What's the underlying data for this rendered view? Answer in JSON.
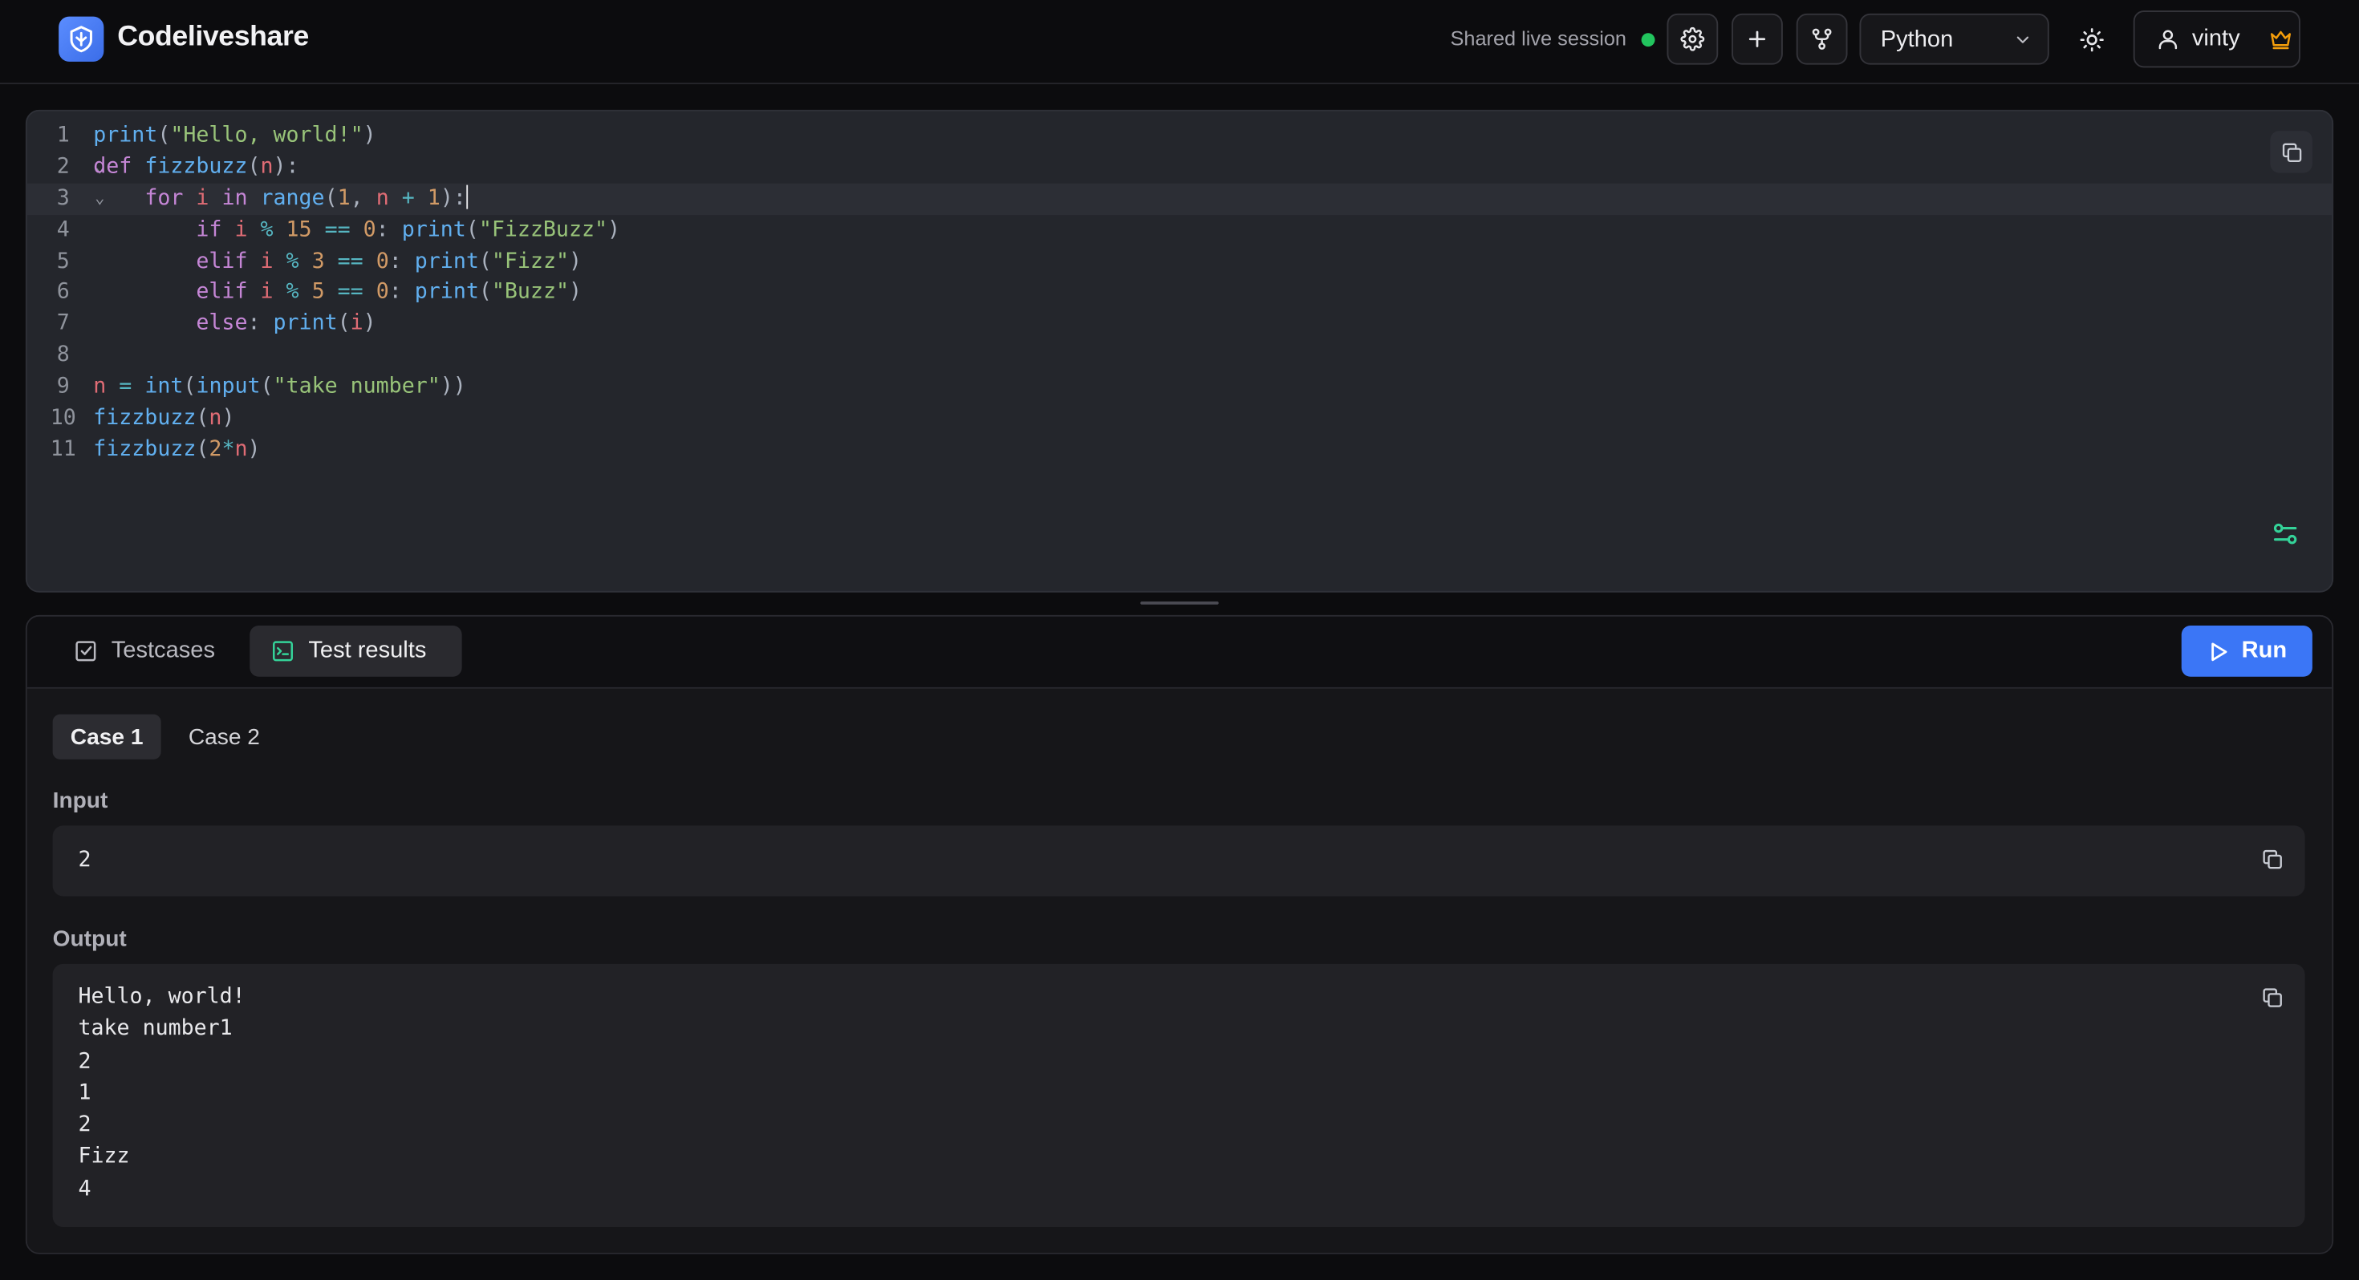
{
  "colors": {
    "accent": "#3b76f6",
    "session_status": "#22c55e",
    "crown": "#f59e0b",
    "settings_accent": "#34d399"
  },
  "header": {
    "brand": "Codeliveshare",
    "session_label": "Shared live session",
    "language": "Python",
    "username": "vinty",
    "icons": [
      "logo-icon",
      "gear-icon",
      "plus-icon",
      "fork-icon",
      "chevron-down-icon",
      "sun-icon",
      "user-icon",
      "crown-icon"
    ]
  },
  "editor": {
    "active_line": 3,
    "lines": [
      {
        "num": "1",
        "fold": false,
        "tokens": [
          {
            "t": "print",
            "c": "f"
          },
          {
            "t": "(",
            "c": "p"
          },
          {
            "t": "\"Hello, world!\"",
            "c": "s"
          },
          {
            "t": ")",
            "c": "p"
          }
        ]
      },
      {
        "num": "2",
        "fold": true,
        "tokens": [
          {
            "t": "def ",
            "c": "k"
          },
          {
            "t": "fizzbuzz",
            "c": "f"
          },
          {
            "t": "(",
            "c": "p"
          },
          {
            "t": "n",
            "c": "v"
          },
          {
            "t": "):",
            "c": "p"
          }
        ]
      },
      {
        "num": "3",
        "fold": true,
        "cursor": true,
        "tokens": [
          {
            "t": "    ",
            "c": "p"
          },
          {
            "t": "for ",
            "c": "k"
          },
          {
            "t": "i ",
            "c": "v"
          },
          {
            "t": "in ",
            "c": "k"
          },
          {
            "t": "range",
            "c": "f"
          },
          {
            "t": "(",
            "c": "p"
          },
          {
            "t": "1",
            "c": "n"
          },
          {
            "t": ", ",
            "c": "p"
          },
          {
            "t": "n ",
            "c": "v"
          },
          {
            "t": "+ ",
            "c": "o"
          },
          {
            "t": "1",
            "c": "n"
          },
          {
            "t": "):",
            "c": "p"
          }
        ]
      },
      {
        "num": "4",
        "fold": false,
        "tokens": [
          {
            "t": "        ",
            "c": "p"
          },
          {
            "t": "if ",
            "c": "k"
          },
          {
            "t": "i ",
            "c": "v"
          },
          {
            "t": "% ",
            "c": "o"
          },
          {
            "t": "15 ",
            "c": "n"
          },
          {
            "t": "== ",
            "c": "o"
          },
          {
            "t": "0",
            "c": "n"
          },
          {
            "t": ": ",
            "c": "p"
          },
          {
            "t": "print",
            "c": "f"
          },
          {
            "t": "(",
            "c": "p"
          },
          {
            "t": "\"FizzBuzz\"",
            "c": "s"
          },
          {
            "t": ")",
            "c": "p"
          }
        ]
      },
      {
        "num": "5",
        "fold": false,
        "tokens": [
          {
            "t": "        ",
            "c": "p"
          },
          {
            "t": "elif ",
            "c": "k"
          },
          {
            "t": "i ",
            "c": "v"
          },
          {
            "t": "% ",
            "c": "o"
          },
          {
            "t": "3 ",
            "c": "n"
          },
          {
            "t": "== ",
            "c": "o"
          },
          {
            "t": "0",
            "c": "n"
          },
          {
            "t": ": ",
            "c": "p"
          },
          {
            "t": "print",
            "c": "f"
          },
          {
            "t": "(",
            "c": "p"
          },
          {
            "t": "\"Fizz\"",
            "c": "s"
          },
          {
            "t": ")",
            "c": "p"
          }
        ]
      },
      {
        "num": "6",
        "fold": false,
        "tokens": [
          {
            "t": "        ",
            "c": "p"
          },
          {
            "t": "elif ",
            "c": "k"
          },
          {
            "t": "i ",
            "c": "v"
          },
          {
            "t": "% ",
            "c": "o"
          },
          {
            "t": "5 ",
            "c": "n"
          },
          {
            "t": "== ",
            "c": "o"
          },
          {
            "t": "0",
            "c": "n"
          },
          {
            "t": ": ",
            "c": "p"
          },
          {
            "t": "print",
            "c": "f"
          },
          {
            "t": "(",
            "c": "p"
          },
          {
            "t": "\"Buzz\"",
            "c": "s"
          },
          {
            "t": ")",
            "c": "p"
          }
        ]
      },
      {
        "num": "7",
        "fold": false,
        "tokens": [
          {
            "t": "        ",
            "c": "p"
          },
          {
            "t": "else",
            "c": "k"
          },
          {
            "t": ": ",
            "c": "p"
          },
          {
            "t": "print",
            "c": "f"
          },
          {
            "t": "(",
            "c": "p"
          },
          {
            "t": "i",
            "c": "v"
          },
          {
            "t": ")",
            "c": "p"
          }
        ]
      },
      {
        "num": "8",
        "fold": false,
        "tokens": []
      },
      {
        "num": "9",
        "fold": false,
        "tokens": [
          {
            "t": "n ",
            "c": "v"
          },
          {
            "t": "= ",
            "c": "o"
          },
          {
            "t": "int",
            "c": "f"
          },
          {
            "t": "(",
            "c": "p"
          },
          {
            "t": "input",
            "c": "f"
          },
          {
            "t": "(",
            "c": "p"
          },
          {
            "t": "\"take number\"",
            "c": "s"
          },
          {
            "t": "))",
            "c": "p"
          }
        ]
      },
      {
        "num": "10",
        "fold": false,
        "tokens": [
          {
            "t": "fizzbuzz",
            "c": "f"
          },
          {
            "t": "(",
            "c": "p"
          },
          {
            "t": "n",
            "c": "v"
          },
          {
            "t": ")",
            "c": "p"
          }
        ]
      },
      {
        "num": "11",
        "fold": false,
        "tokens": [
          {
            "t": "fizzbuzz",
            "c": "f"
          },
          {
            "t": "(",
            "c": "p"
          },
          {
            "t": "2",
            "c": "n"
          },
          {
            "t": "*",
            "c": "o"
          },
          {
            "t": "n",
            "c": "v"
          },
          {
            "t": ")",
            "c": "p"
          }
        ]
      }
    ]
  },
  "panel": {
    "tabs": [
      {
        "label": "Testcases",
        "active": false
      },
      {
        "label": "Test results",
        "active": true
      }
    ],
    "run_label": "Run",
    "cases": [
      {
        "label": "Case 1",
        "active": true
      },
      {
        "label": "Case 2",
        "active": false
      }
    ],
    "input_label": "Input",
    "input_value": "2",
    "output_label": "Output",
    "output_lines": [
      "Hello, world!",
      "take number1",
      "2",
      "1",
      "2",
      "Fizz",
      "4"
    ]
  }
}
